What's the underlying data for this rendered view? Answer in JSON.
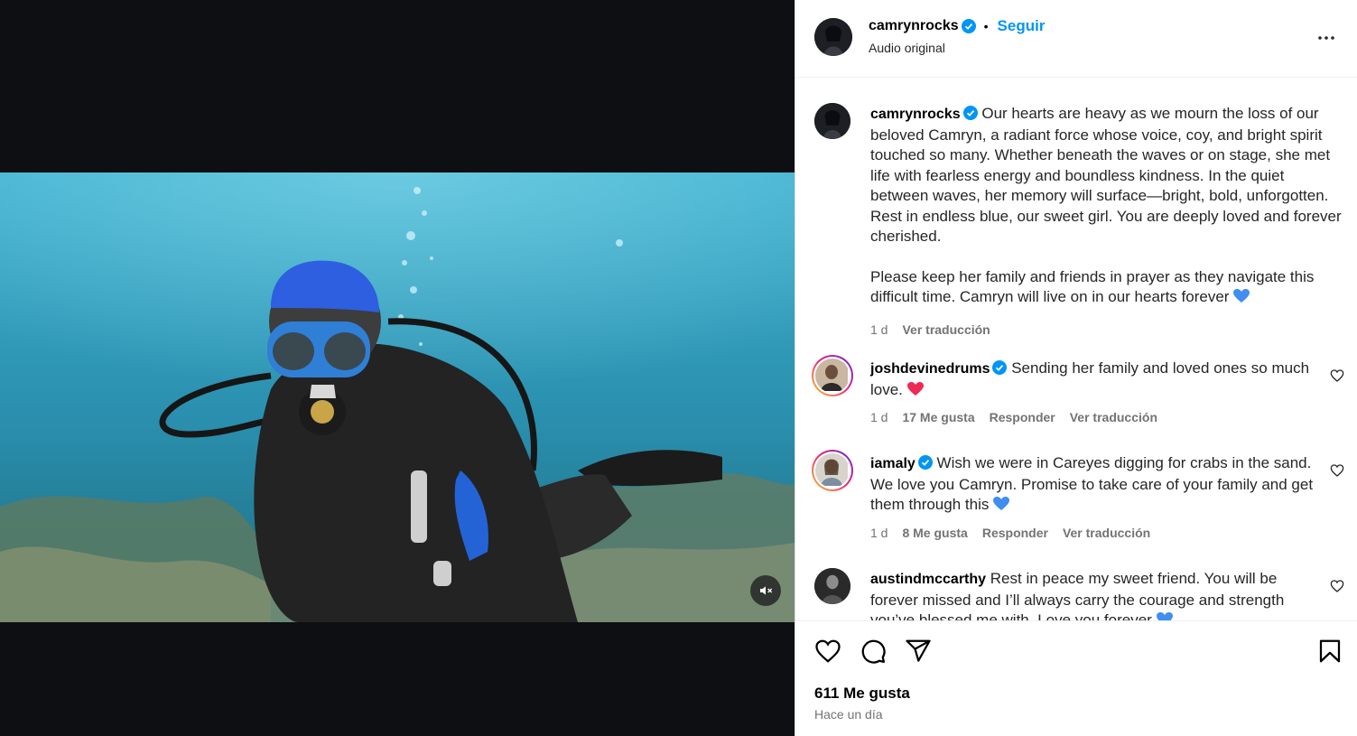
{
  "post": {
    "username": "camrynrocks",
    "follow_label": "Seguir",
    "audio_label": "Audio original",
    "separator": "•"
  },
  "caption": {
    "username": "camrynrocks",
    "paragraph1": "Our hearts are heavy as we mourn the loss of our beloved Camryn, a radiant force whose voice, coy, and bright spirit touched so many. Whether beneath the waves or on stage, she met life with fearless energy and boundless kindness. In the quiet between waves, her memory will surface—bright, bold, unforgotten. Rest in endless blue, our sweet girl. You are deeply loved and forever cherished.",
    "paragraph2": "Please keep her family and friends in prayer as they navigate this difficult time. Camryn will live on in our hearts forever",
    "paragraph2_emoji": "blue-heart",
    "age": "1 d",
    "translate": "Ver traducción"
  },
  "comments": [
    {
      "username": "joshdevinedrums",
      "verified": true,
      "text": "Sending her family and loved ones so much love.",
      "emoji": "red-heart",
      "age": "1 d",
      "likes": "17 Me gusta",
      "reply": "Responder",
      "translate": "Ver traducción"
    },
    {
      "username": "iamaly",
      "verified": true,
      "text": "Wish we were in Careyes digging for crabs in the sand. We love you Camryn. Promise to take care of your family and get them through this",
      "emoji": "blue-heart",
      "age": "1 d",
      "likes": "8 Me gusta",
      "reply": "Responder",
      "translate": "Ver traducción"
    },
    {
      "username": "austindmccarthy",
      "verified": false,
      "text": "Rest in peace my sweet friend. You will be forever missed and I’ll always carry the courage and strength you’ve blessed me with. Love you forever",
      "emoji": "blue-heart",
      "age": "",
      "likes": "",
      "reply": "",
      "translate": ""
    }
  ],
  "footer": {
    "likes": "611 Me gusta",
    "time": "Hace un día"
  },
  "colors": {
    "link_blue": "#0095f6",
    "verified_blue": "#0095f6",
    "muted_text": "#737373",
    "water_top": "#3aa6c6",
    "water_bottom": "#1d6f86"
  },
  "icons": [
    "verified-badge-icon",
    "more-options-icon",
    "muted-speaker-icon",
    "like-heart-icon",
    "comment-icon",
    "share-icon",
    "save-bookmark-icon"
  ]
}
